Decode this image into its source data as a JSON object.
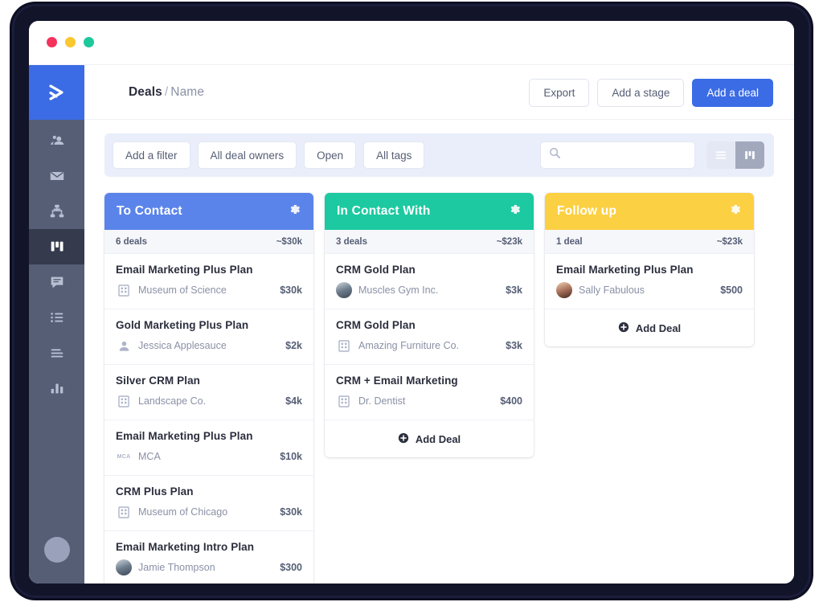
{
  "window": {
    "traffic_lights": [
      "close",
      "minimize",
      "maximize"
    ]
  },
  "sidebar": {
    "logo": "activecampaign-logo",
    "items": [
      {
        "name": "contacts",
        "icon": "people-icon",
        "active": false
      },
      {
        "name": "campaigns",
        "icon": "envelope-icon",
        "active": false
      },
      {
        "name": "automations",
        "icon": "flowchart-icon",
        "active": false
      },
      {
        "name": "deals",
        "icon": "kanban-icon",
        "active": true
      },
      {
        "name": "conversations",
        "icon": "chat-icon",
        "active": false
      },
      {
        "name": "lists",
        "icon": "list-icon",
        "active": false
      },
      {
        "name": "forms",
        "icon": "text-lines-icon",
        "active": false
      },
      {
        "name": "reports",
        "icon": "bar-chart-icon",
        "active": false
      }
    ],
    "avatar": "user-avatar"
  },
  "header": {
    "breadcrumb_root": "Deals",
    "breadcrumb_sep": "/",
    "breadcrumb_current": "Name",
    "buttons": {
      "export": "Export",
      "add_stage": "Add a stage",
      "add_deal": "Add a deal"
    }
  },
  "filters": {
    "add_filter": "Add a filter",
    "deal_owners": "All deal owners",
    "status": "Open",
    "tags": "All tags",
    "search_value": "",
    "search_placeholder": "",
    "view_list": "list-view",
    "view_board": "board-view",
    "active_view": "board-view"
  },
  "colors": {
    "accent_blue": "#3b6ce5",
    "stage_to_contact": "#5a84ea",
    "stage_in_contact": "#1cc9a0",
    "stage_follow_up": "#fcd043",
    "sidebar": "#555e75",
    "sidebar_active": "#353b4d",
    "filter_bar": "#eaeefa"
  },
  "board": {
    "add_deal_label": "Add Deal",
    "columns": [
      {
        "title": "To Contact",
        "color": "#5a84ea",
        "deals_count": "6 deals",
        "total": "~$30k",
        "show_add_deal": false,
        "has_partial_card": true,
        "cards": [
          {
            "title": "Email Marketing Plus Plan",
            "company": "Museum of Science",
            "amount": "$30k",
            "icon": "building-icon"
          },
          {
            "title": "Gold Marketing Plus Plan",
            "company": "Jessica Applesauce",
            "amount": "$2k",
            "icon": "person-icon"
          },
          {
            "title": "Silver CRM Plan",
            "company": "Landscape Co.",
            "amount": "$4k",
            "icon": "building-icon"
          },
          {
            "title": "Email Marketing Plus Plan",
            "company": "MCA",
            "amount": "$10k",
            "icon": "mca-logo-icon"
          },
          {
            "title": "CRM Plus Plan",
            "company": "Museum of Chicago",
            "amount": "$30k",
            "icon": "building-icon"
          },
          {
            "title": "Email Marketing Intro Plan",
            "company": "Jamie Thompson",
            "amount": "$300",
            "icon": "avatar-photo-icon"
          }
        ]
      },
      {
        "title": "In Contact With",
        "color": "#1cc9a0",
        "deals_count": "3 deals",
        "total": "~$23k",
        "show_add_deal": true,
        "has_partial_card": false,
        "cards": [
          {
            "title": "CRM Gold Plan",
            "company": "Muscles Gym Inc.",
            "amount": "$3k",
            "icon": "avatar-photo-icon"
          },
          {
            "title": "CRM Gold Plan",
            "company": "Amazing Furniture Co.",
            "amount": "$3k",
            "icon": "building-icon"
          },
          {
            "title": "CRM + Email Marketing",
            "company": "Dr. Dentist",
            "amount": "$400",
            "icon": "building-icon"
          }
        ]
      },
      {
        "title": "Follow up",
        "color": "#fcd043",
        "deals_count": "1 deal",
        "total": "~$23k",
        "show_add_deal": true,
        "has_partial_card": false,
        "cards": [
          {
            "title": "Email Marketing Plus Plan",
            "company": "Sally Fabulous",
            "amount": "$500",
            "icon": "avatar-photo-icon"
          }
        ]
      }
    ]
  }
}
